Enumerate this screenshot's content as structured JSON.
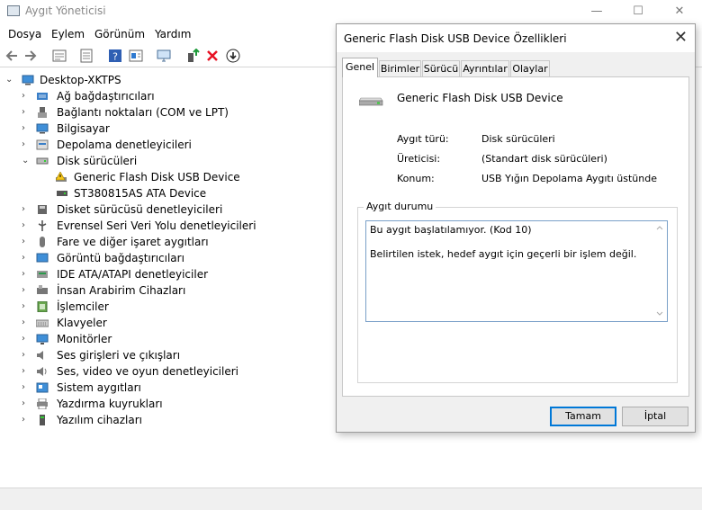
{
  "window": {
    "title": "Aygıt Yöneticisi",
    "controls": [
      "—",
      "☐",
      "✕"
    ]
  },
  "menu": [
    "Dosya",
    "Eylem",
    "Görünüm",
    "Yardım"
  ],
  "tree": {
    "root": "Desktop-XKTPS",
    "items": [
      {
        "label": "Ağ bağdaştırıcıları",
        "expanded": false
      },
      {
        "label": "Bağlantı noktaları (COM ve LPT)",
        "expanded": false
      },
      {
        "label": "Bilgisayar",
        "expanded": false
      },
      {
        "label": "Depolama denetleyicileri",
        "expanded": false
      },
      {
        "label": "Disk sürücüleri",
        "expanded": true
      },
      {
        "label": "Generic Flash Disk USB Device",
        "child": true,
        "warning": true
      },
      {
        "label": "ST380815AS ATA Device",
        "child": true
      },
      {
        "label": "Disket sürücüsü denetleyicileri",
        "expanded": false
      },
      {
        "label": "Evrensel Seri Veri Yolu denetleyicileri",
        "expanded": false
      },
      {
        "label": "Fare ve diğer işaret aygıtları",
        "expanded": false
      },
      {
        "label": "Görüntü bağdaştırıcıları",
        "expanded": false
      },
      {
        "label": "IDE ATA/ATAPI denetleyiciler",
        "expanded": false
      },
      {
        "label": "İnsan Arabirim Cihazları",
        "expanded": false
      },
      {
        "label": "İşlemciler",
        "expanded": false
      },
      {
        "label": "Klavyeler",
        "expanded": false
      },
      {
        "label": "Monitörler",
        "expanded": false
      },
      {
        "label": "Ses girişleri ve çıkışları",
        "expanded": false
      },
      {
        "label": "Ses, video ve oyun denetleyicileri",
        "expanded": false
      },
      {
        "label": "Sistem aygıtları",
        "expanded": false
      },
      {
        "label": "Yazdırma kuyrukları",
        "expanded": false
      },
      {
        "label": "Yazılım cihazları",
        "expanded": false
      }
    ]
  },
  "dialog": {
    "title": "Generic Flash Disk USB Device Özellikleri",
    "tabs": [
      "Genel",
      "Birimler",
      "Sürücü",
      "Ayrıntılar",
      "Olaylar"
    ],
    "device_name": "Generic Flash Disk USB Device",
    "props": [
      {
        "label": "Aygıt türü:",
        "value": "Disk sürücüleri"
      },
      {
        "label": "Üreticisi:",
        "value": "(Standart disk sürücüleri)"
      },
      {
        "label": "Konum:",
        "value": "USB Yığın Depolama Aygıtı üstünde"
      }
    ],
    "status_legend": "Aygıt durumu",
    "status_line1": "Bu aygıt başlatılamıyor. (Kod 10)",
    "status_line2": "Belirtilen istek, hedef aygıt için geçerli bir işlem değil.",
    "ok_label": "Tamam",
    "cancel_label": "İptal"
  },
  "colors": {
    "accent": "#0078d7",
    "warning": "#f5c518",
    "delete": "#e81123"
  }
}
